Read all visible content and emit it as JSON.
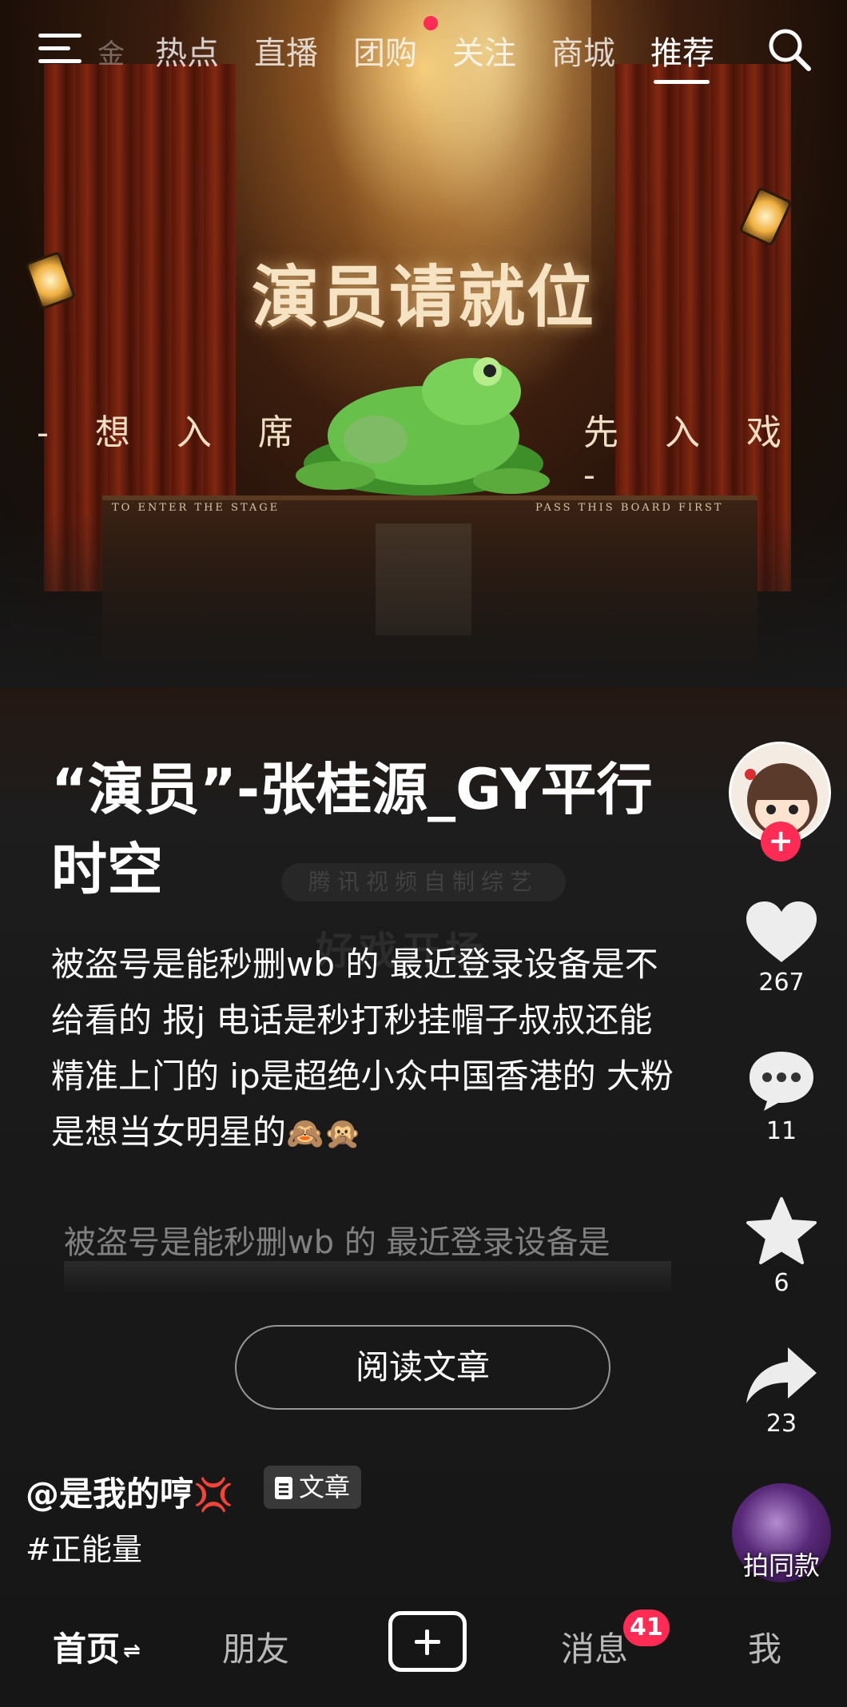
{
  "top_nav": {
    "faded_tab": "金",
    "tabs": [
      {
        "label": "热点"
      },
      {
        "label": "直播"
      },
      {
        "label": "团购"
      },
      {
        "label": "关注"
      },
      {
        "label": "商城"
      },
      {
        "label": "推荐"
      }
    ],
    "active_tab": "推荐"
  },
  "poster": {
    "title": "演员请就位",
    "left_slogan": "- 想 入 席",
    "right_slogan": "先 入 戏 -",
    "left_caption": "TO ENTER THE STAGE",
    "right_caption": "PASS THIS BOARD FIRST",
    "watermark_line1": "腾讯视频自制综艺",
    "watermark_line2": "好戏开场"
  },
  "post": {
    "title": "“演员”-张桂源_GY平行时空",
    "description": "被盗号是能秒删wb 的 最近登录设备是不给看的 报j 电话是秒打秒挂帽子叔叔还能精准上门的 ip是超绝小众中国香港的 大粉是想当女明星的",
    "description_emoji": "🙈🙊",
    "ghost_line": "被盗号是能秒删wb 的 最近登录设备是",
    "read_button": "阅读文章",
    "author": "@是我的哼",
    "author_emoji": "💢",
    "type_badge": "文章",
    "hashtag": "#正能量"
  },
  "right_rail": {
    "follow": "+",
    "likes": "267",
    "comments": "11",
    "favorites": "6",
    "shares": "23",
    "same_style": "拍同款"
  },
  "bottom_nav": {
    "home": "首页",
    "home_switch": "⇌",
    "friends": "朋友",
    "messages": "消息",
    "messages_badge": "41",
    "me": "我"
  },
  "colors": {
    "accent": "#fe2c55",
    "background": "#161616"
  }
}
